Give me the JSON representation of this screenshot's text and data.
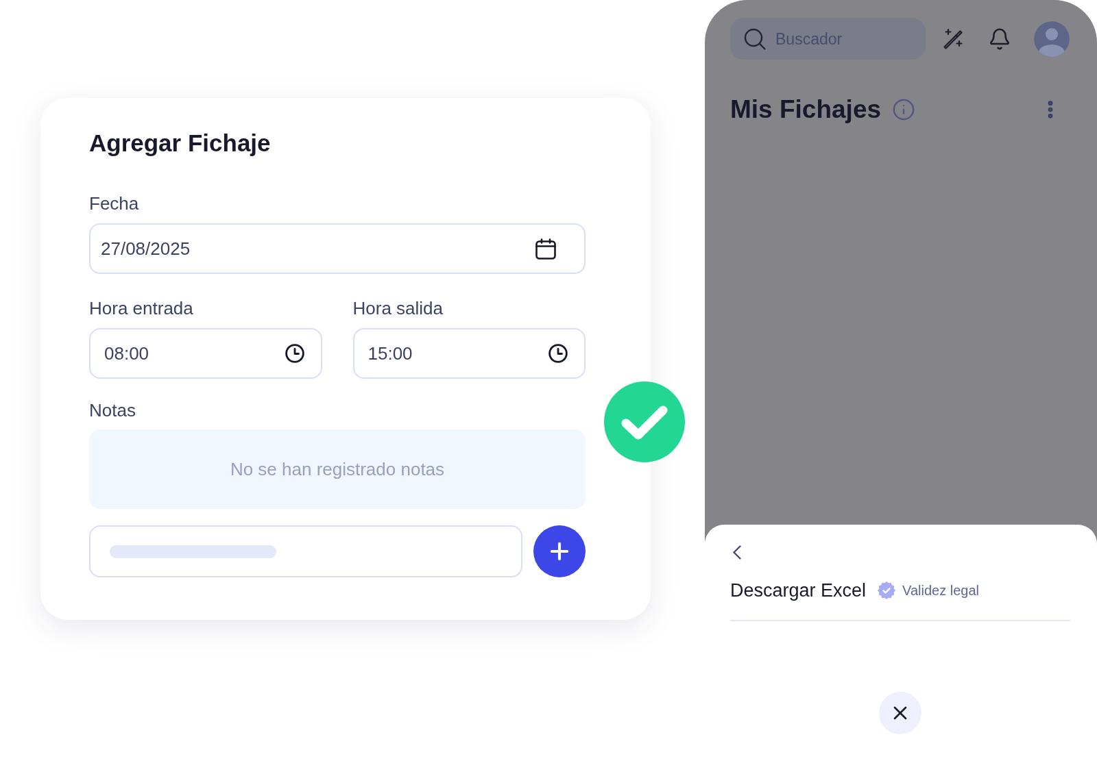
{
  "form": {
    "title": "Agregar Fichaje",
    "fields": [
      {
        "kind": "date",
        "label": "Fecha",
        "value": "27/08/2025"
      },
      {
        "kind": "time",
        "label": "Hora entrada",
        "value": "08:00"
      },
      {
        "kind": "time",
        "label": "Hora salida",
        "value": "15:00"
      }
    ],
    "notes": {
      "label": "Notas",
      "empty_message": "No se han registrado notas"
    }
  },
  "app": {
    "search": {
      "placeholder": "Buscador"
    },
    "title": "Mis Fichajes",
    "sheet": {
      "option": "Descargar Excel",
      "badge": "Validez legal"
    }
  }
}
